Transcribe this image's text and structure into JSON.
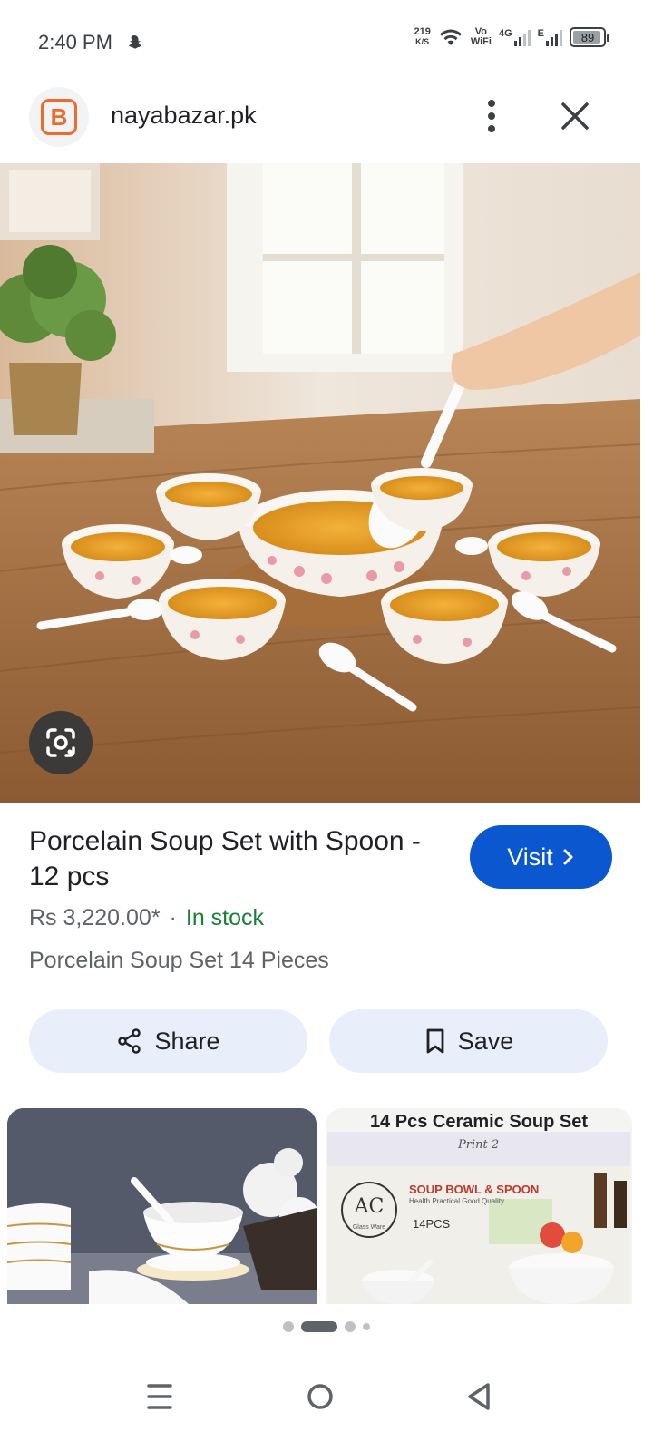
{
  "status_bar": {
    "time": "2:40 PM",
    "net_speed_value": "219",
    "net_speed_unit": "K/S",
    "vowifi_top": "Vo",
    "vowifi_bottom": "WiFi",
    "network_4g": "4G",
    "network_e": "E",
    "battery": "89"
  },
  "header": {
    "site_name": "nayabazar.pk",
    "logo_letter": "B"
  },
  "product": {
    "title": "Porcelain Soup Set with Spoon - 12 pcs",
    "visit_label": "Visit",
    "price": "Rs 3,220.00*",
    "separator": "·",
    "availability": "In stock",
    "subtitle": "Porcelain Soup Set 14 Pieces"
  },
  "actions": {
    "share_label": "Share",
    "save_label": "Save"
  },
  "related": {
    "thumb2_title": "14 Pcs Ceramic Soup Set",
    "thumb2_print": "Print 2",
    "thumb2_brand": "SOUP BOWL & SPOON",
    "thumb2_tagline": "Health Practical Good Quality",
    "thumb2_count": "14PCS",
    "thumb2_logo": "AC",
    "thumb2_logo_sub": "Glass Ware"
  },
  "pagination": {
    "page_count": 4,
    "active_index": 1
  },
  "colors": {
    "accent": "#0b57d0",
    "in_stock": "#188038",
    "action_bg": "#e8eefa",
    "logo": "#f06a2a"
  }
}
